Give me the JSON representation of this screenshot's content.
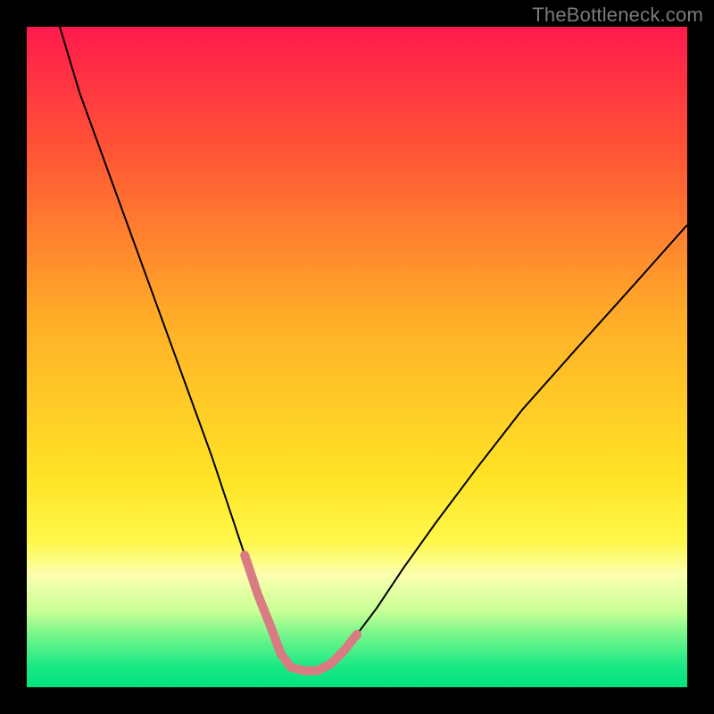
{
  "watermark": "TheBottleneck.com",
  "chart_data": {
    "type": "line",
    "title": "",
    "xlabel": "",
    "ylabel": "",
    "xlim": [
      0,
      100
    ],
    "ylim": [
      0,
      100
    ],
    "grid": false,
    "legend": false,
    "background_gradient": {
      "stops": [
        {
          "offset": 0.0,
          "color": "#ff1a4d"
        },
        {
          "offset": 0.18,
          "color": "#ff5236"
        },
        {
          "offset": 0.45,
          "color": "#ffb028"
        },
        {
          "offset": 0.68,
          "color": "#ffe326"
        },
        {
          "offset": 0.78,
          "color": "#fff84a"
        },
        {
          "offset": 0.83,
          "color": "#fbffb0"
        },
        {
          "offset": 0.885,
          "color": "#c8ff96"
        },
        {
          "offset": 0.925,
          "color": "#6cf58a"
        },
        {
          "offset": 0.97,
          "color": "#18e884"
        },
        {
          "offset": 1.0,
          "color": "#00e37e"
        }
      ]
    },
    "series": [
      {
        "name": "bottleneck-curve",
        "stroke": "#000000",
        "stroke_width": 2,
        "x": [
          5,
          8,
          12,
          16,
          20,
          24,
          28,
          31,
          33,
          35,
          37,
          38.5,
          40,
          42,
          44,
          46,
          48,
          50,
          53,
          57,
          62,
          68,
          75,
          83,
          92,
          100
        ],
        "y": [
          100,
          90,
          79,
          68,
          57,
          46,
          35,
          26,
          20,
          14,
          9,
          5,
          3,
          2.5,
          2.5,
          3.5,
          5.5,
          8,
          12,
          18,
          25,
          33,
          42,
          51,
          61,
          70
        ]
      },
      {
        "name": "sweet-spot-band",
        "stroke": "#d97b82",
        "stroke_width": 10,
        "linecap": "round",
        "x": [
          33,
          35,
          37,
          38.5,
          40,
          42,
          44,
          46,
          48,
          50
        ],
        "y": [
          20,
          14,
          9,
          5,
          3,
          2.5,
          2.5,
          3.5,
          5.5,
          8
        ]
      }
    ],
    "annotations": []
  }
}
